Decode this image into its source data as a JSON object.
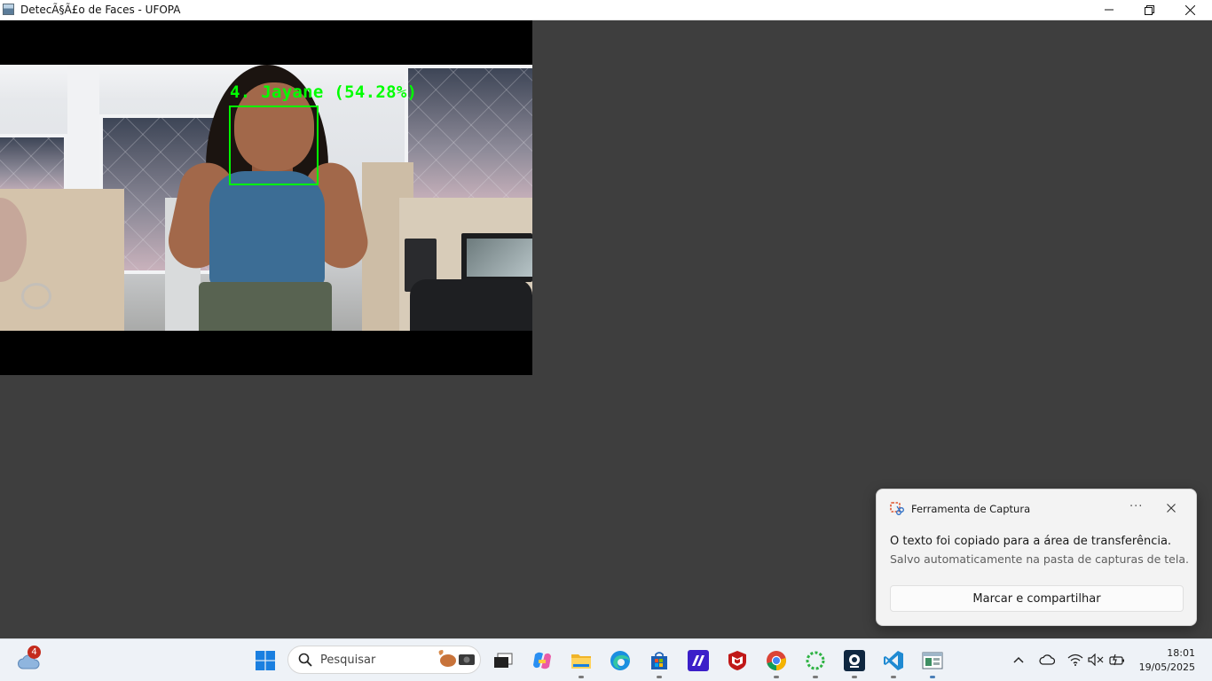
{
  "window": {
    "title": "DetecÃ§Ã£o de Faces - UFOPA",
    "controls": [
      "minimize",
      "restore",
      "close"
    ]
  },
  "video": {
    "detection_label": "4. Jayane (54.28%)",
    "detection_color": "#00ff00"
  },
  "toast": {
    "app_name": "Ferramenta de Captura",
    "more_label": "···",
    "title": "O texto foi copiado para a área de transferência.",
    "body": "Salvo automaticamente na pasta de capturas de tela.",
    "button_label": "Marcar e compartilhar"
  },
  "taskbar": {
    "weather_badge": "4",
    "search_placeholder": "Pesquisar",
    "apps": [
      "start-icon",
      "task-view-icon",
      "copilot-icon",
      "file-explorer-icon",
      "edge-icon",
      "store-icon",
      "app-icon",
      "mcafee-icon",
      "chrome-icon",
      "loading-app-icon",
      "webcam-app-icon",
      "vscode-icon",
      "python-window-icon"
    ],
    "clock_time": "18:01",
    "clock_date": "19/05/2025"
  },
  "colors": {
    "client_bg": "#3e3e3e",
    "taskbar_bg": "#eef2f7",
    "accent": "#0078d4"
  }
}
